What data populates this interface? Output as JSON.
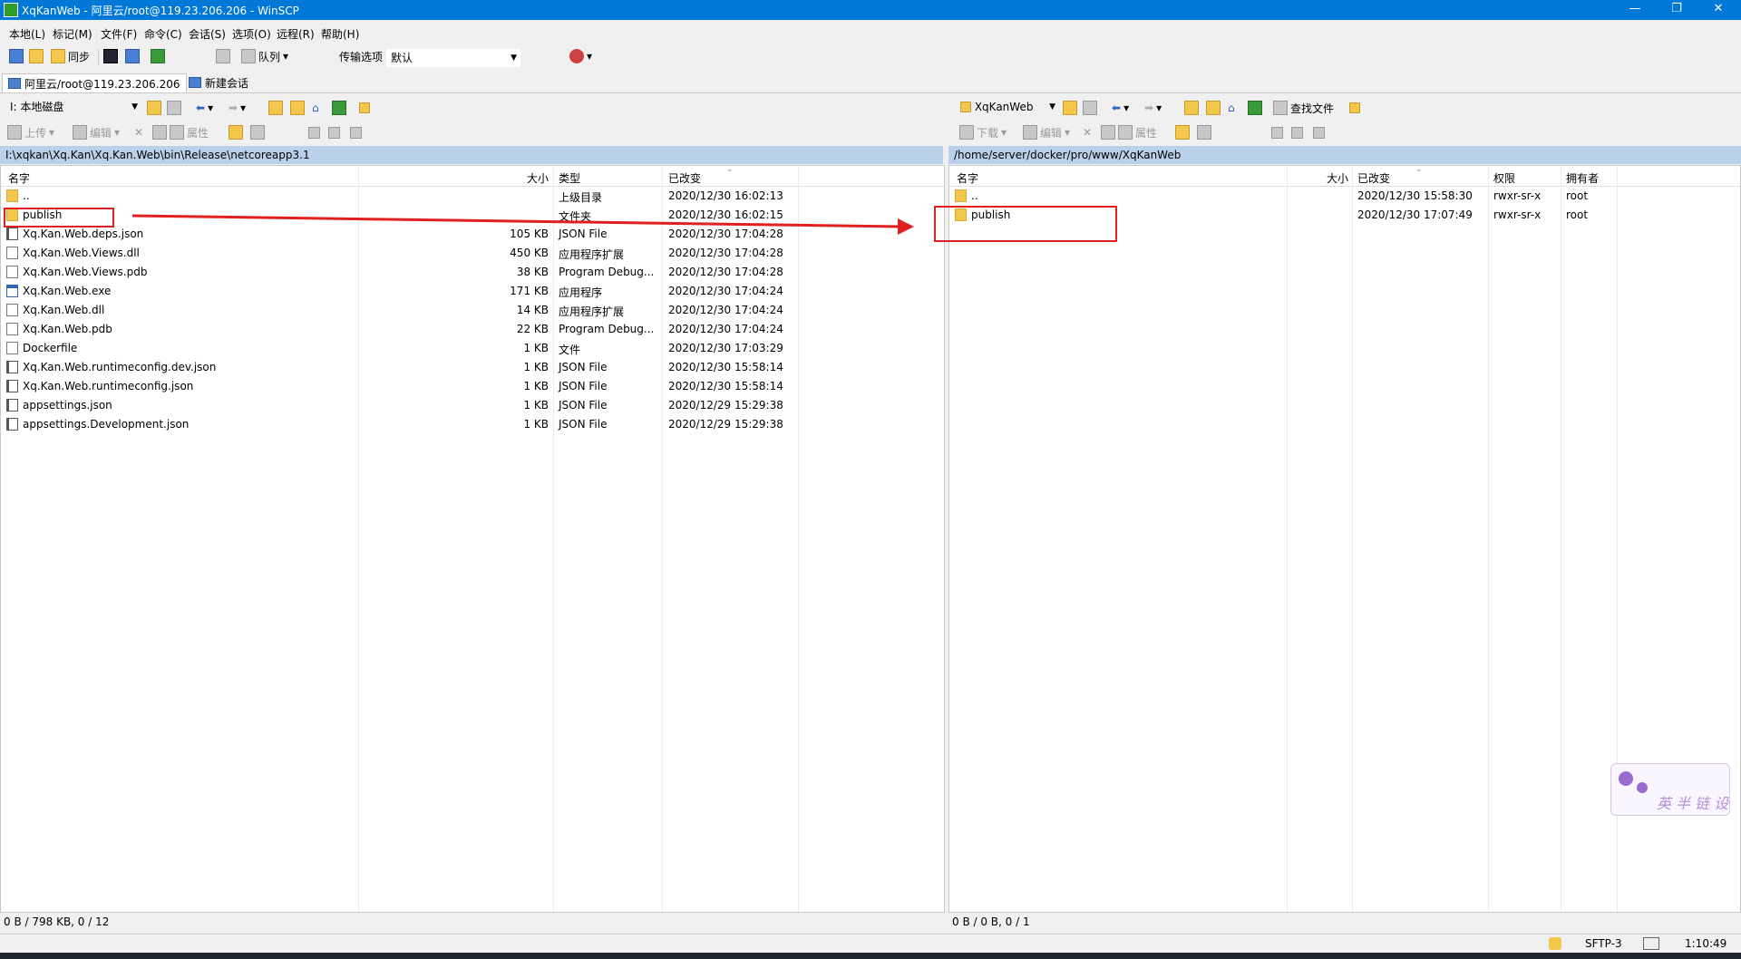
{
  "window": {
    "title": "XqKanWeb - 阿里云/root@119.23.206.206 - WinSCP",
    "controls": [
      "—",
      "❐",
      "✕"
    ]
  },
  "menu": [
    "本地(L)",
    "标记(M)",
    "文件(F)",
    "命令(C)",
    "会话(S)",
    "选项(O)",
    "远程(R)",
    "帮助(H)"
  ],
  "toolbar": {
    "sync_label": "同步",
    "queue_label": "队列",
    "transfer_label": "传输选项",
    "transfer_value": "默认"
  },
  "tabs": [
    {
      "label": "阿里云/root@119.23.206.206"
    },
    {
      "label": "新建会话"
    }
  ],
  "left": {
    "drive": "I: 本地磁盘",
    "actions": {
      "upload": "上传",
      "edit": "编辑",
      "properties": "属性"
    },
    "path": "I:\\xqkan\\Xq.Kan\\Xq.Kan.Web\\bin\\Release\\netcoreapp3.1",
    "columns": {
      "name": "名字",
      "size": "大小",
      "type": "类型",
      "modified": "已改变"
    },
    "files": [
      {
        "icon": "up",
        "name": "..",
        "size": "",
        "type": "上级目录",
        "modified": "2020/12/30  16:02:13"
      },
      {
        "icon": "folder",
        "name": "publish",
        "size": "",
        "type": "文件夹",
        "modified": "2020/12/30  16:02:15"
      },
      {
        "icon": "json",
        "name": "Xq.Kan.Web.deps.json",
        "size": "105 KB",
        "type": "JSON File",
        "modified": "2020/12/30  17:04:28"
      },
      {
        "icon": "doc",
        "name": "Xq.Kan.Web.Views.dll",
        "size": "450 KB",
        "type": "应用程序扩展",
        "modified": "2020/12/30  17:04:28"
      },
      {
        "icon": "doc",
        "name": "Xq.Kan.Web.Views.pdb",
        "size": "38 KB",
        "type": "Program Debug...",
        "modified": "2020/12/30  17:04:28"
      },
      {
        "icon": "exe",
        "name": "Xq.Kan.Web.exe",
        "size": "171 KB",
        "type": "应用程序",
        "modified": "2020/12/30  17:04:24"
      },
      {
        "icon": "doc",
        "name": "Xq.Kan.Web.dll",
        "size": "14 KB",
        "type": "应用程序扩展",
        "modified": "2020/12/30  17:04:24"
      },
      {
        "icon": "doc",
        "name": "Xq.Kan.Web.pdb",
        "size": "22 KB",
        "type": "Program Debug...",
        "modified": "2020/12/30  17:04:24"
      },
      {
        "icon": "doc",
        "name": "Dockerfile",
        "size": "1 KB",
        "type": "文件",
        "modified": "2020/12/30  17:03:29"
      },
      {
        "icon": "json",
        "name": "Xq.Kan.Web.runtimeconfig.dev.json",
        "size": "1 KB",
        "type": "JSON File",
        "modified": "2020/12/30  15:58:14"
      },
      {
        "icon": "json",
        "name": "Xq.Kan.Web.runtimeconfig.json",
        "size": "1 KB",
        "type": "JSON File",
        "modified": "2020/12/30  15:58:14"
      },
      {
        "icon": "json",
        "name": "appsettings.json",
        "size": "1 KB",
        "type": "JSON File",
        "modified": "2020/12/29  15:29:38"
      },
      {
        "icon": "json",
        "name": "appsettings.Development.json",
        "size": "1 KB",
        "type": "JSON File",
        "modified": "2020/12/29  15:29:38"
      }
    ],
    "status": "0 B / 798 KB,   0 / 12"
  },
  "right": {
    "drive": "XqKanWeb",
    "find_label": "查找文件",
    "actions": {
      "download": "下载",
      "edit": "编辑",
      "properties": "属性"
    },
    "path": "/home/server/docker/pro/www/XqKanWeb",
    "columns": {
      "name": "名字",
      "size": "大小",
      "modified": "已改变",
      "rights": "权限",
      "owner": "拥有者"
    },
    "files": [
      {
        "icon": "up",
        "name": "..",
        "size": "",
        "modified": "2020/12/30 15:58:30",
        "rights": "rwxr-sr-x",
        "owner": "root"
      },
      {
        "icon": "folder",
        "name": "publish",
        "size": "",
        "modified": "2020/12/30 17:07:49",
        "rights": "rwxr-sr-x",
        "owner": "root"
      }
    ],
    "status": "0 B / 0 B,   0 / 1"
  },
  "bottom": {
    "protocol": "SFTP-3",
    "time": "1:10:49"
  },
  "watermark": {
    "text": "英 半 链 设"
  },
  "colors": {
    "titlebar": "#0078d7",
    "path_bar": "#b9d1ea",
    "annotation": "#e02020"
  }
}
